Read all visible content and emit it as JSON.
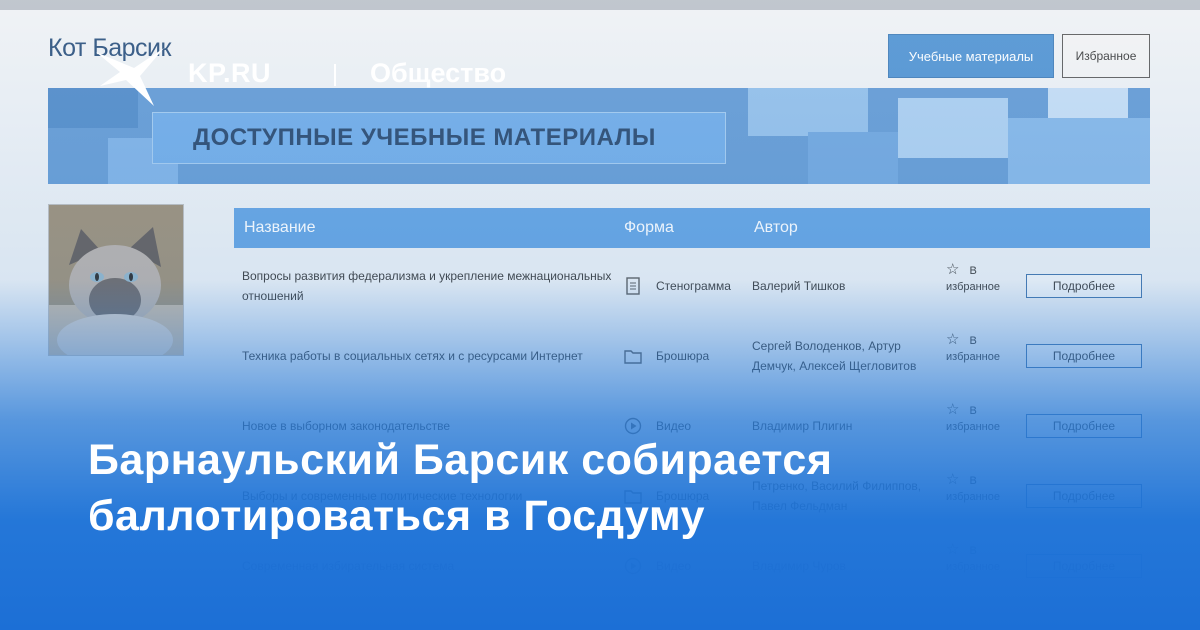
{
  "site": {
    "brand": "KP.RU",
    "separator": "|",
    "section": "Общество"
  },
  "headline": "Барнаульский Барсик собирается баллотироваться в Госдуму",
  "screenshot": {
    "profile_name": "Кот Барсик",
    "nav": {
      "materials_button": "Учебные материалы",
      "favorites_button": "Избранное"
    },
    "banner_title": "ДОСТУПНЫЕ УЧЕБНЫЕ МАТЕРИАЛЫ",
    "table": {
      "headers": {
        "name": "Название",
        "form": "Форма",
        "author": "Автор"
      },
      "rows": [
        {
          "title": "Вопросы развития федерализма и укрепление межнациональных отношений",
          "form": "Стенограмма",
          "form_icon": "document-icon",
          "author": "Валерий Тишков",
          "fav": "В избранное",
          "more": "Подробнее"
        },
        {
          "title": "Техника работы в социальных сетях и с ресурсами Интернет",
          "form": "Брошюра",
          "form_icon": "folder-icon",
          "author": "Сергей Володенков, Артур Демчук, Алексей Щегловитов",
          "fav": "В избранное",
          "more": "Подробнее"
        },
        {
          "title": "Новое в выборном законодательстве",
          "form": "Видео",
          "form_icon": "play-icon",
          "author": "Владимир Плигин",
          "fav": "В избранное",
          "more": "Подробнее"
        },
        {
          "title": "Выборы и современные политические технологии",
          "form": "Брошюра",
          "form_icon": "folder-icon",
          "author": "Петренко, Василий Филиппов, Павел Фельдман",
          "fav": "В избранное",
          "more": "Подробнее"
        },
        {
          "title": "Современная избирательная система",
          "form": "Видео",
          "form_icon": "play-icon",
          "author": "Владимир Чуров",
          "fav": "В избранное",
          "more": "Подробнее"
        }
      ]
    }
  },
  "colors": {
    "brand_blue": "#1c6fd6",
    "table_header": "#5d9fe0",
    "banner_blue": "#5d96d2",
    "headline_text": "#ffffff"
  }
}
